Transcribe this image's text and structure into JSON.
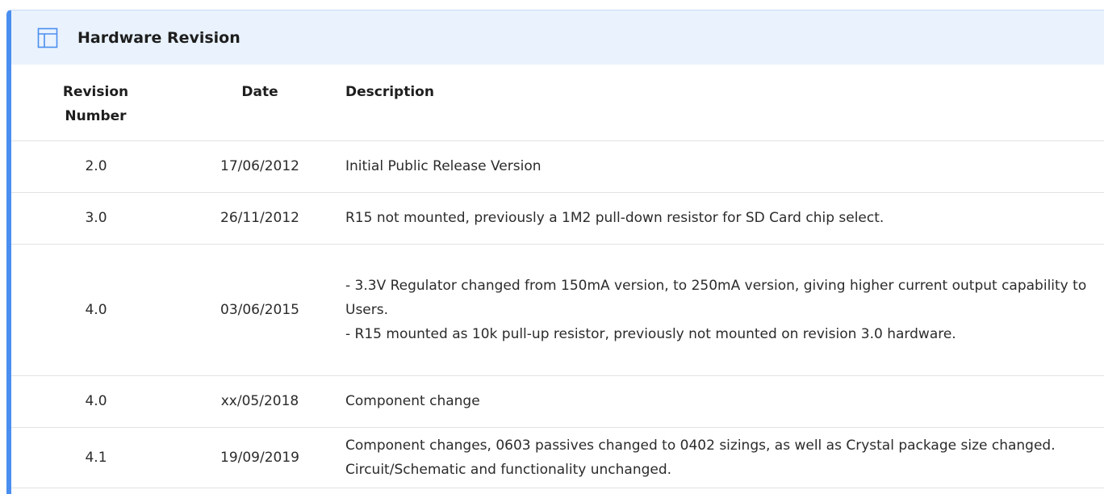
{
  "panel": {
    "title": "Hardware Revision",
    "icon": "table-icon",
    "accent_color": "#4a8ef0",
    "header_bg": "#e9f2fd"
  },
  "table": {
    "headers": {
      "revision_line1": "Revision",
      "revision_line2": "Number",
      "date": "Date",
      "description": "Description"
    },
    "rows": [
      {
        "revision": "2.0",
        "date": "17/06/2012",
        "description": [
          "Initial Public Release Version"
        ]
      },
      {
        "revision": "3.0",
        "date": "26/11/2012",
        "description": [
          "R15 not mounted, previously a 1M2 pull-down resistor for SD Card chip select."
        ]
      },
      {
        "revision": "4.0",
        "date": "03/06/2015",
        "description": [
          "- 3.3V Regulator changed from 150mA version, to 250mA version, giving higher current output capability to Users.",
          "- R15 mounted as 10k pull-up resistor, previously not mounted on revision 3.0 hardware."
        ]
      },
      {
        "revision": "4.0",
        "date": "xx/05/2018",
        "description": [
          "Component change"
        ]
      },
      {
        "revision": "4.1",
        "date": "19/09/2019",
        "description": [
          "Component changes, 0603 passives changed to 0402 sizings, as well as Crystal package size changed. Circuit/Schematic and functionality unchanged."
        ]
      }
    ]
  }
}
